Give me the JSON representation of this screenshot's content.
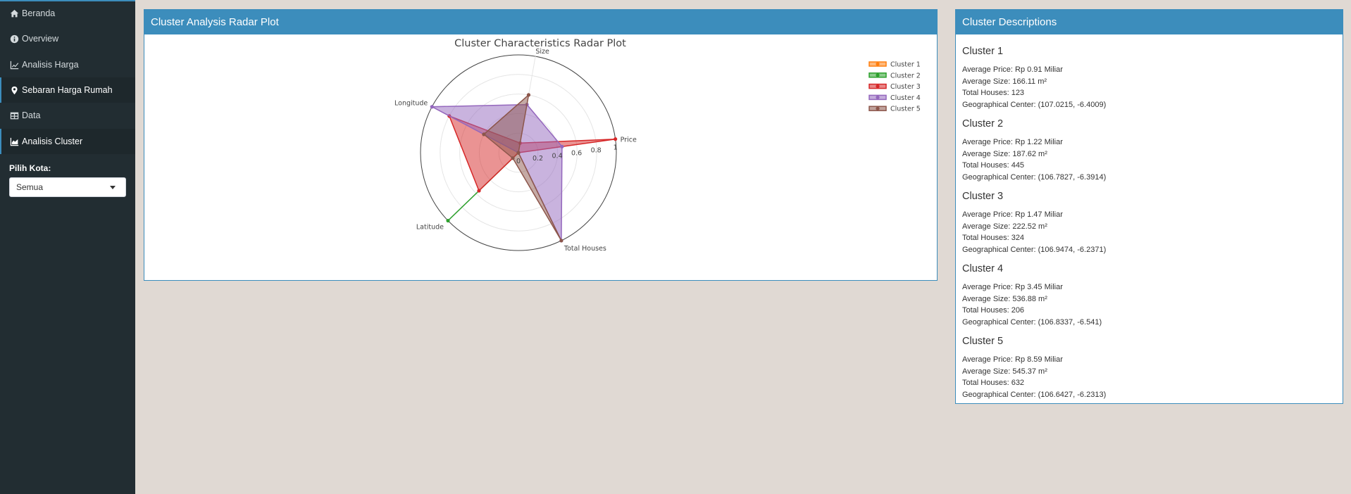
{
  "sidebar": {
    "items": [
      {
        "label": "Beranda",
        "icon": "home-icon"
      },
      {
        "label": "Overview",
        "icon": "info-circle-icon"
      },
      {
        "label": "Analisis Harga",
        "icon": "line-chart-icon"
      },
      {
        "label": "Sebaran Harga Rumah",
        "icon": "map-marker-icon"
      },
      {
        "label": "Data",
        "icon": "table-icon"
      },
      {
        "label": "Analisis Cluster",
        "icon": "area-chart-icon"
      }
    ],
    "filter_label": "Pilih Kota:",
    "filter_value": "Semua"
  },
  "radar_box": {
    "title": "Cluster Analysis Radar Plot"
  },
  "desc_box": {
    "title": "Cluster Descriptions",
    "clusters": [
      {
        "title": "Cluster 1",
        "price": "Average Price: Rp 0.91 Miliar",
        "size": "Average Size: 166.11 m²",
        "houses": "Total Houses: 123",
        "center": "Geographical Center: (107.0215, -6.4009)"
      },
      {
        "title": "Cluster 2",
        "price": "Average Price: Rp 1.22 Miliar",
        "size": "Average Size: 187.62 m²",
        "houses": "Total Houses: 445",
        "center": "Geographical Center: (106.7827, -6.3914)"
      },
      {
        "title": "Cluster 3",
        "price": "Average Price: Rp 1.47 Miliar",
        "size": "Average Size: 222.52 m²",
        "houses": "Total Houses: 324",
        "center": "Geographical Center: (106.9474, -6.2371)"
      },
      {
        "title": "Cluster 4",
        "price": "Average Price: Rp 3.45 Miliar",
        "size": "Average Size: 536.88 m²",
        "houses": "Total Houses: 206",
        "center": "Geographical Center: (106.8337, -6.541)"
      },
      {
        "title": "Cluster 5",
        "price": "Average Price: Rp 8.59 Miliar",
        "size": "Average Size: 545.37 m²",
        "houses": "Total Houses: 632",
        "center": "Geographical Center: (106.6427, -6.2313)"
      }
    ]
  },
  "chart_data": {
    "type": "radar",
    "title": "Cluster Characteristics Radar Plot",
    "axes": [
      "Size",
      "Price",
      "Total Houses",
      "Latitude",
      "Longitude"
    ],
    "radial_ticks": [
      "0",
      "0.2",
      "0.4",
      "0.6",
      "0.8",
      "1"
    ],
    "range": [
      0,
      1
    ],
    "legend_position": "top-right",
    "series": [
      {
        "name": "Cluster 1",
        "color": "#ff7f0e",
        "values": [
          0.0,
          0.0,
          0.0,
          0.0,
          0.0
        ]
      },
      {
        "name": "Cluster 2",
        "color": "#2ca02c",
        "values": [
          0.0,
          0.0,
          0.0,
          1.0,
          0.0
        ]
      },
      {
        "name": "Cluster 3",
        "color": "#d62728",
        "values": [
          0.1,
          1.0,
          0.0,
          0.56,
          0.8
        ]
      },
      {
        "name": "Cluster 4",
        "color": "#9467bd",
        "values": [
          0.5,
          0.45,
          1.0,
          0.0,
          1.0
        ]
      },
      {
        "name": "Cluster 5",
        "color": "#8c564b",
        "values": [
          0.6,
          0.0,
          1.0,
          0.08,
          0.4
        ]
      }
    ]
  }
}
